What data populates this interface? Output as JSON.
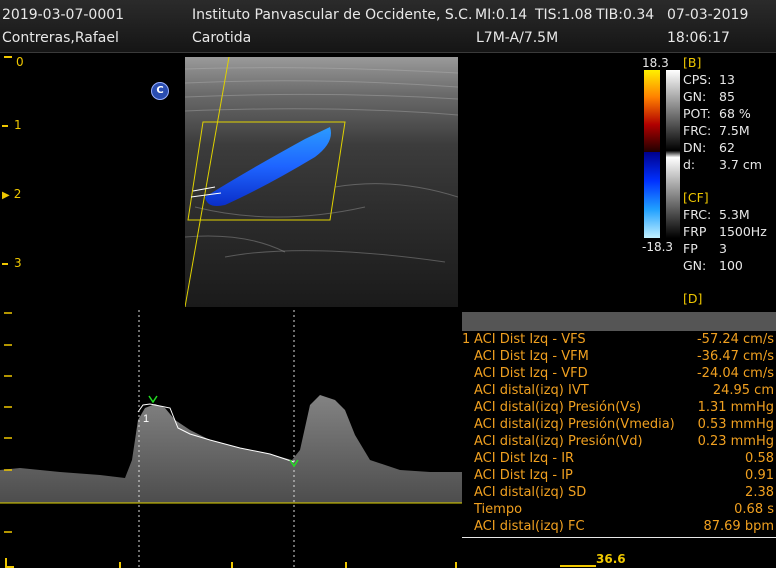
{
  "header": {
    "patient_id": "2019-03-07-0001",
    "patient_name": "Contreras,Rafael",
    "institution": "Instituto Panvascular de Occidente, S.C.",
    "mi": "MI:0.14",
    "tis": "TIS:1.08",
    "tib": "TIB:0.34",
    "date": "07-03-2019",
    "exam": "Carotida",
    "probe": "L7M-A/7.5M",
    "time": "18:06:17"
  },
  "depth_scale": [
    "0",
    "1",
    "2",
    "3"
  ],
  "color_map": {
    "top": "18.3",
    "bottom": "-18.3"
  },
  "orientation_marker": "C",
  "b_mode": {
    "title": "[B]",
    "params": [
      {
        "k": "CPS:",
        "v": "13"
      },
      {
        "k": "GN:",
        "v": "85"
      },
      {
        "k": "POT:",
        "v": "68 %"
      },
      {
        "k": "FRC:",
        "v": "7.5M"
      },
      {
        "k": "DN:",
        "v": "62"
      },
      {
        "k": "d:",
        "v": "3.7 cm"
      }
    ]
  },
  "cf_mode": {
    "title": "[CF]",
    "params": [
      {
        "k": "FRC:",
        "v": "5.3M"
      },
      {
        "k": "FRP",
        "v": "1500Hz"
      },
      {
        "k": "FP",
        "v": "3"
      },
      {
        "k": "GN:",
        "v": "100"
      }
    ]
  },
  "d_mode": {
    "title": "[D]"
  },
  "cursor_marker": "1",
  "measurements": [
    {
      "index": "1",
      "label": "ACI Dist Izq - VFS",
      "value": "-57.24 cm/s"
    },
    {
      "index": "",
      "label": "ACI Dist Izq - VFM",
      "value": "-36.47 cm/s"
    },
    {
      "index": "",
      "label": "ACI Dist Izq - VFD",
      "value": "-24.04 cm/s"
    },
    {
      "index": "",
      "label": "ACI distal(izq) IVT",
      "value": "24.95 cm"
    },
    {
      "index": "",
      "label": "ACI distal(izq) Presión(Vs)",
      "value": "1.31 mmHg"
    },
    {
      "index": "",
      "label": "ACI distal(izq) Presión(Vmedia)",
      "value": "0.53 mmHg"
    },
    {
      "index": "",
      "label": "ACI distal(izq) Presión(Vd)",
      "value": "0.23 mmHg"
    },
    {
      "index": "",
      "label": "ACI Dist Izq - IR",
      "value": "0.58"
    },
    {
      "index": "",
      "label": "ACI Dist Izq - IP",
      "value": "0.91"
    },
    {
      "index": "",
      "label": "ACI distal(izq) SD",
      "value": "2.38"
    },
    {
      "index": "",
      "label": "Tiempo",
      "value": "0.68 s"
    },
    {
      "index": "",
      "label": "ACI distal(izq) FC",
      "value": "87.69 bpm"
    }
  ],
  "bottom_value": "36.6",
  "colors": {
    "accent": "#f0c800",
    "measure_text": "#f0a020",
    "flow_blue": "#1e64ff"
  }
}
